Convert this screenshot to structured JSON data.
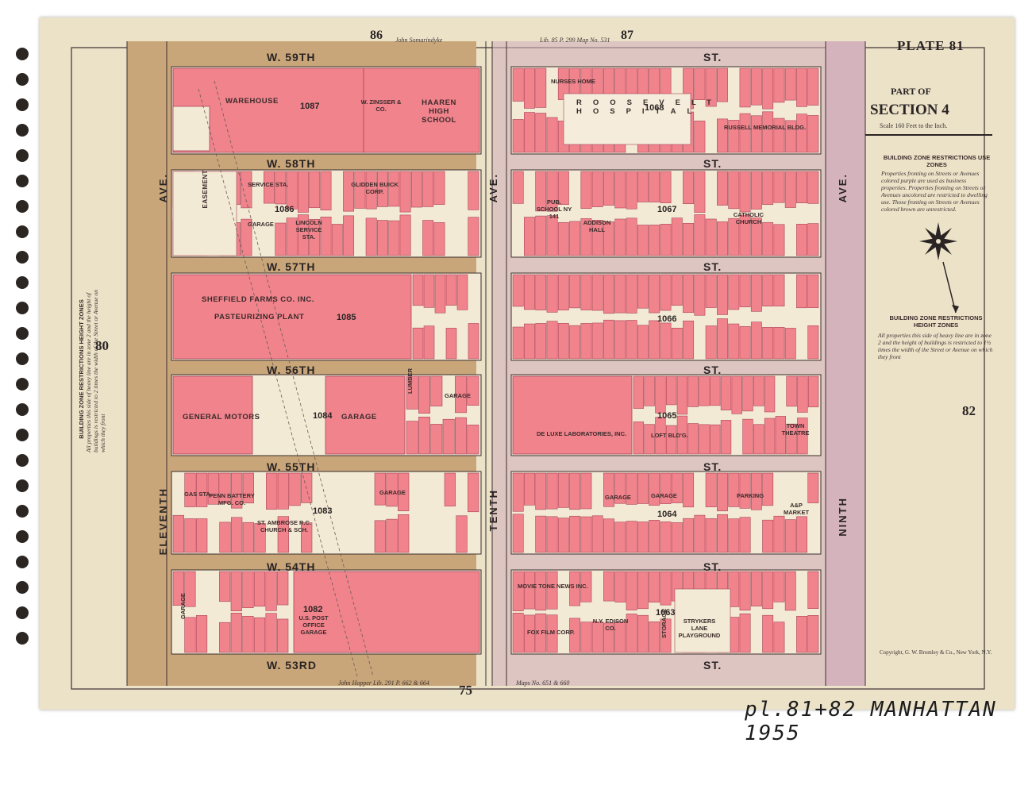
{
  "plate": "PLATE 81",
  "section": {
    "part": "PART OF",
    "name": "SECTION 4",
    "scale": "Scale 160 Feet to the Inch."
  },
  "adjacent_plates": {
    "top_left": "86",
    "top_right": "87",
    "left": "80",
    "right": "82",
    "bottom": "75"
  },
  "streets": {
    "w59": "W. 59TH",
    "w58": "W. 58TH",
    "w57": "W. 57TH",
    "w56": "W. 56TH",
    "w55": "W. 55TH",
    "w54": "W. 54TH",
    "w53": "W. 53RD",
    "st": "ST."
  },
  "avenues": {
    "eleventh": "ELEVENTH",
    "ave": "AVE.",
    "tenth": "TENTH",
    "ninth": "NINTH",
    "easement": "EASEMENT"
  },
  "blocks": [
    "1087",
    "1086",
    "1085",
    "1084",
    "1083",
    "1082",
    "1068",
    "1067",
    "1066",
    "1065",
    "1064",
    "1063"
  ],
  "labels": {
    "warehouse": "WAREHOUSE",
    "zinsser": "W. ZINSSER & CO.",
    "haaren": "HAAREN HIGH SCHOOL",
    "roosevelt": "ROOSEVELT HOSPITAL",
    "nurses": "NURSES HOME",
    "russell": "RUSSELL MEMORIAL BLDG.",
    "service_sta": "SERVICE STA.",
    "glidden": "GLIDDEN BUICK CORP.",
    "lincoln": "LINCOLN SERVICE STA.",
    "garage": "GARAGE",
    "pub_school": "PUB. SCHOOL NY 141",
    "addison": "ADDISON HALL",
    "catholic": "CATHOLIC CHURCH",
    "sheffield": "SHEFFIELD FARMS CO. INC.",
    "pasteurizing": "PASTEURIZING PLANT",
    "general_motors": "GENERAL MOTORS",
    "lumber": "LUMBER",
    "deluxe": "DE LUXE LABORATORIES, INC.",
    "loft": "LOFT BLD'G.",
    "town_theatre": "TOWN THEATRE",
    "gas_sta": "GAS STA.",
    "penn_battery": "PENN BATTERY MFG. CO.",
    "st_ambrose": "ST. AMBROSE R.C. CHURCH & SCH.",
    "parking": "PARKING",
    "market": "A&P MARKET",
    "post_office": "U.S. POST OFFICE GARAGE",
    "movietone": "MOVIE TONE NEWS INC.",
    "fox": "FOX FILM CORP.",
    "edison": "N.Y. EDISON CO.",
    "strykers": "STRYKERS LANE PLAYGROUND",
    "storage": "STORAGE"
  },
  "legend": {
    "use_title": "BUILDING ZONE RESTRICTIONS USE ZONES",
    "use_text": "Properties fronting on Streets or Avenues colored purple are used as business properties. Properties fronting on Streets or Avenues uncolored are restricted to dwelling use. Those fronting on Streets or Avenues colored brown are unrestricted.",
    "height_title": "BUILDING ZONE RESTRICTIONS HEIGHT ZONES",
    "height_text": "All properties this side of heavy line are in zone 2 and the height of buildings is restricted to 1½ times the width of the Street or Avenue on which they front",
    "left_title": "BUILDING ZONE RESTRICTIONS HEIGHT ZONES",
    "left_text": "All properties this side of heavy line are in zone 2 and the height of buildings is restricted to 2 times the width of the Street or Avenue on which they front"
  },
  "margin_notes": {
    "top": "John Somarindyke",
    "top_right": "Lib. 85 P. 299 Map No. 531",
    "bottom_left": "John Hopper Lib. 291 P. 662 & 664",
    "bottom_right": "Maps No. 651 & 660"
  },
  "copyright": "Copyright, G. W. Bromley & Co., New York, N.Y.",
  "handwritten": "pl.81+82 MANHATTAN 1955",
  "colors": {
    "paper": "#ece2c8",
    "building": "#f0838c",
    "building_edge": "#a8475a",
    "brown_zone": "#c9a679",
    "purple_zone": "#d4b3bd",
    "lot": "#f3ead5"
  }
}
